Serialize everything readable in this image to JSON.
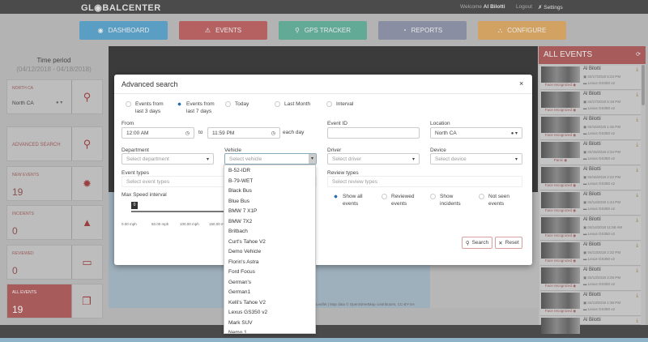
{
  "header": {
    "logo": "GL◉BALCENTER",
    "welcome_prefix": "Welcome",
    "user": "Al Bilotti",
    "logout": "Logout",
    "settings": "Settings"
  },
  "nav": [
    {
      "label": "DASHBOARD",
      "icon": "dashboard-icon",
      "color": "#5a9ec4"
    },
    {
      "label": "EVENTS",
      "icon": "warning-icon",
      "color": "#b56161"
    },
    {
      "label": "GPS TRACKER",
      "icon": "map-pin-icon",
      "color": "#62a996"
    },
    {
      "label": "REPORTS",
      "icon": "chart-icon",
      "color": "#8a8ea3"
    },
    {
      "label": "CONFIGURE",
      "icon": "sitemap-icon",
      "color": "#d2a262"
    }
  ],
  "left": {
    "time_period_label": "Time period",
    "time_period": "(04/12/2018 - 04/18/2018)",
    "location_label": "NORTH CA",
    "location_value": "North CA",
    "advanced_search": "ADVANCED SEARCH",
    "new_events_label": "NEW EVENTS",
    "new_events": "19",
    "incidents_label": "INCIDENTS",
    "incidents": "0",
    "reviewed_label": "REVIEWED",
    "reviewed": "0",
    "all_events_label": "ALL EVENTS",
    "all_events": "19"
  },
  "map": {
    "attribution": "Leaflet | Map data © OpenStreetMap contributors, CC-BY-SA"
  },
  "events_panel": {
    "title": "ALL EVENTS",
    "items": [
      {
        "name": "Al Bilotti",
        "date": "04/17/2018 5:23 PM",
        "vehicle": "Lexus GS350 v2",
        "tag": "Face recognized"
      },
      {
        "name": "Al Bilotti",
        "date": "04/17/2018 5:18 PM",
        "vehicle": "Lexus GS350 v2",
        "tag": "Face recognized"
      },
      {
        "name": "Al Bilotti",
        "date": "04/16/2018 1:45 PM",
        "vehicle": "Lexus GS350 v2",
        "tag": "Face recognized"
      },
      {
        "name": "Al Bilotti",
        "date": "04/16/2018 2:34 PM",
        "vehicle": "Lexus GS350 v2",
        "tag": "Panic"
      },
      {
        "name": "Al Bilotti",
        "date": "04/16/2018 2:22 PM",
        "vehicle": "Lexus GS350 v2",
        "tag": "Face recognized"
      },
      {
        "name": "Al Bilotti",
        "date": "04/14/2018 1:44 PM",
        "vehicle": "Lexus GS350 v2",
        "tag": "Face recognized"
      },
      {
        "name": "Al Bilotti",
        "date": "04/14/2018 11:58 AM",
        "vehicle": "Lexus GS350 v2",
        "tag": "Face recognized"
      },
      {
        "name": "Al Bilotti",
        "date": "04/13/2018 2:32 PM",
        "vehicle": "Lexus GS350 v2",
        "tag": "Face recognized"
      },
      {
        "name": "Al Bilotti",
        "date": "04/13/2018 2:25 PM",
        "vehicle": "Lexus GS350 v2",
        "tag": "Face recognized"
      },
      {
        "name": "Al Bilotti",
        "date": "04/13/2018 1:38 PM",
        "vehicle": "Lexus GS350 v2",
        "tag": "Face recognized"
      },
      {
        "name": "Al Bilotti",
        "date": "",
        "vehicle": "",
        "tag": ""
      }
    ]
  },
  "modal": {
    "title": "Advanced search",
    "close": "×",
    "periods": [
      {
        "label": "Events from last 3 days",
        "selected": false
      },
      {
        "label": "Events from last 7 days",
        "selected": true
      },
      {
        "label": "Today",
        "selected": false
      },
      {
        "label": "Last Month",
        "selected": false
      },
      {
        "label": "Interval",
        "selected": false
      }
    ],
    "from_label": "From",
    "from_value": "12:00 AM",
    "to_label": "to",
    "to_value": "11:59 PM",
    "each_day": "each day",
    "event_id_label": "Event ID",
    "event_id_value": "",
    "location_label": "Location",
    "location_value": "North CA",
    "department_label": "Department",
    "department_placeholder": "Select department",
    "vehicle_label": "Vehicle",
    "vehicle_placeholder": "Select vehicle",
    "driver_label": "Driver",
    "driver_placeholder": "Select driver",
    "device_label": "Device",
    "device_placeholder": "Select device",
    "event_types_label": "Event types",
    "event_types_placeholder": "Select event types",
    "review_types_label": "Review types",
    "review_types_placeholder": "Select review types",
    "speed_label": "Max Speed interval",
    "speed_handle": "0",
    "speed_value": 0,
    "speed_ticks": [
      "0.00 mph",
      "50.00 mph",
      "100.00 mph",
      "150.00 mph"
    ],
    "review_filters": [
      {
        "label": "Show all events",
        "selected": true
      },
      {
        "label": "Reviewed events",
        "selected": false
      },
      {
        "label": "Show incidents",
        "selected": false
      },
      {
        "label": "Not seen events",
        "selected": false
      }
    ],
    "search": "Search",
    "reset": "Reset",
    "vehicle_options": [
      "B-52-IDR",
      "B-79-WET",
      "Black Bus",
      "Blue Bus",
      "BMW 7 X1P",
      "BMW 7X2",
      "Britbach",
      "Curt's Tahoe V2",
      "Demo Vehicle",
      "Florin's Astra",
      "Ford Focus",
      "German's",
      "German1",
      "Kelli's Tahoe V2",
      "Lexus GS350 v2",
      "Mark SUV",
      "Nemo 1"
    ]
  }
}
